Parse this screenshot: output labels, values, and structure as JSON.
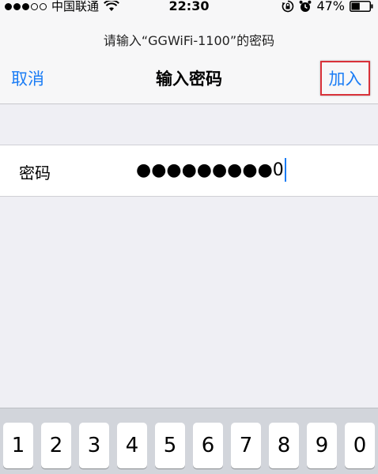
{
  "status_bar": {
    "carrier": "中国联通",
    "time": "22:30",
    "battery": "47%"
  },
  "prompt": "请输入“GGWiFi-1100”的密码",
  "nav": {
    "cancel": "取消",
    "title": "输入密码",
    "join": "加入"
  },
  "password_field": {
    "label": "密码",
    "value": "●●●●●●●●●0"
  },
  "keyboard": {
    "keys": [
      "1",
      "2",
      "3",
      "4",
      "5",
      "6",
      "7",
      "8",
      "9",
      "0"
    ]
  },
  "colors": {
    "accent": "#1a7cf5",
    "highlight_border": "#d9323a"
  }
}
